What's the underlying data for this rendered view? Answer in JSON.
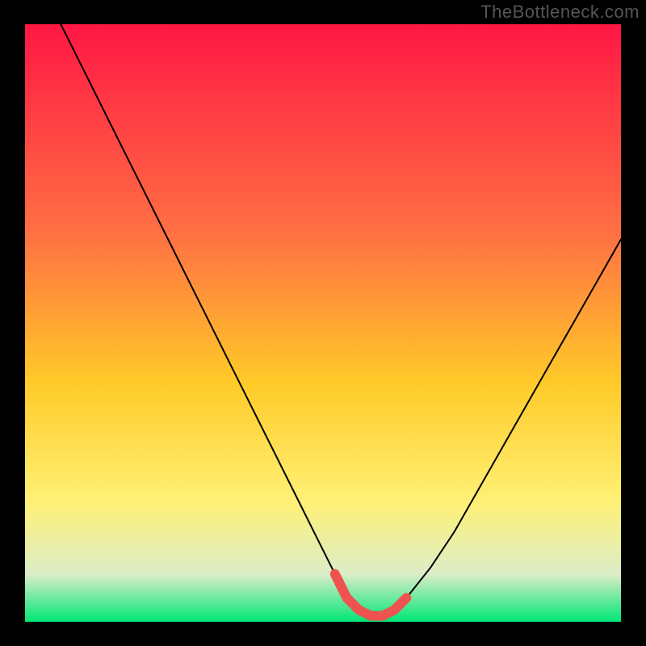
{
  "watermark": "TheBottleneck.com",
  "colors": {
    "bg": "#000000",
    "grad_top": "#ff1744",
    "grad_mid1": "#ff7043",
    "grad_mid2": "#ffca28",
    "grad_mid3": "#fff176",
    "grad_mid4": "#dcedc8",
    "grad_bottom": "#00e676",
    "curve": "#000000",
    "marker": "#ef5350"
  },
  "chart_data": {
    "type": "line",
    "title": "",
    "xlabel": "",
    "ylabel": "",
    "xlim": [
      0,
      100
    ],
    "ylim": [
      0,
      100
    ],
    "series": [
      {
        "name": "bottleneck-curve",
        "x": [
          6,
          10,
          14,
          18,
          22,
          26,
          30,
          34,
          38,
          42,
          46,
          50,
          52,
          54,
          56,
          58,
          60,
          62,
          64,
          68,
          72,
          76,
          80,
          84,
          88,
          92,
          96,
          100
        ],
        "y": [
          100,
          92,
          84,
          76,
          68,
          60,
          52,
          44,
          36,
          28,
          20,
          12,
          8,
          4,
          2,
          1,
          1,
          2,
          4,
          9,
          15,
          22,
          29,
          36,
          43,
          50,
          57,
          64
        ]
      }
    ],
    "marker": {
      "name": "optimal-range",
      "x": [
        52,
        54,
        56,
        58,
        60,
        62,
        64
      ],
      "y": [
        8,
        4,
        2,
        1,
        1,
        2,
        4
      ]
    },
    "gradient_axis": "vertical",
    "grid": false,
    "legend": false
  }
}
